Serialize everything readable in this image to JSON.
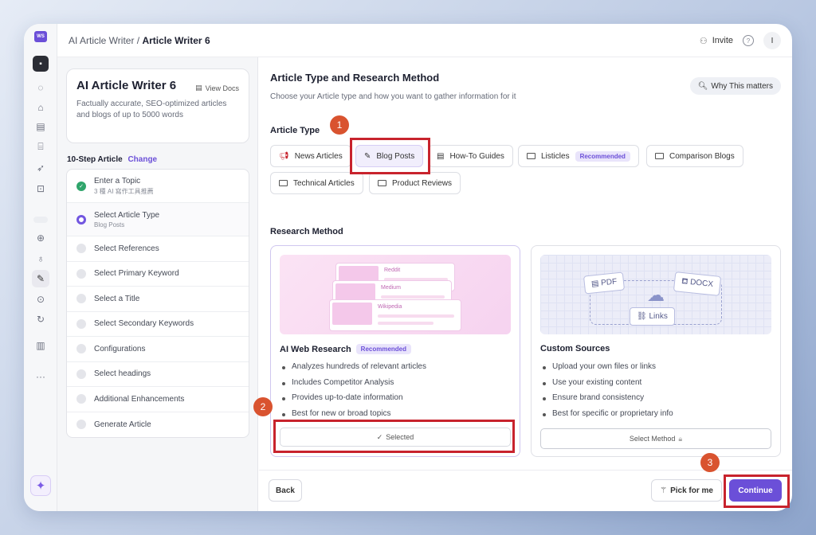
{
  "app": {
    "logo_text": "WS",
    "breadcrumb_parent": "AI Article Writer / ",
    "breadcrumb_current": "Article Writer 6",
    "invite_label": "Invite",
    "help_icon": "?",
    "user_initial": "I"
  },
  "rail": {
    "icons": [
      "layout-icon",
      "spinner-icon",
      "home-icon",
      "document-icon",
      "code-icon",
      "rocket-icon",
      "robot-icon",
      "search-icon",
      "lightbulb-icon",
      "pencil-icon",
      "upload-icon",
      "refresh-icon",
      "chart-icon",
      "more-icon"
    ],
    "more_label": "···",
    "spark_label": "✦"
  },
  "left": {
    "title": "AI Article Writer 6",
    "view_docs": "View Docs",
    "description": "Factually accurate, SEO-optimized articles and blogs of up to 5000 words",
    "step_heading": "10-Step Article",
    "change_label": "Change",
    "steps": [
      {
        "label": "Enter a Topic",
        "sub": "3 種 AI 寫作工具推薦",
        "status": "done"
      },
      {
        "label": "Select Article Type",
        "sub": "Blog Posts",
        "status": "current"
      },
      {
        "label": "Select References",
        "sub": "",
        "status": "pending"
      },
      {
        "label": "Select Primary Keyword",
        "sub": "",
        "status": "pending"
      },
      {
        "label": "Select a Title",
        "sub": "",
        "status": "pending"
      },
      {
        "label": "Select Secondary Keywords",
        "sub": "",
        "status": "pending"
      },
      {
        "label": "Configurations",
        "sub": "",
        "status": "pending"
      },
      {
        "label": "Select headings",
        "sub": "",
        "status": "pending"
      },
      {
        "label": "Additional Enhancements",
        "sub": "",
        "status": "pending"
      },
      {
        "label": "Generate Article",
        "sub": "",
        "status": "pending"
      }
    ]
  },
  "main": {
    "title": "Article Type and Research Method",
    "subtitle": "Choose your Article type and how you want to gather information for it",
    "why_button": "Why This matters",
    "article_type_label": "Article Type",
    "article_types": [
      {
        "label": "News Articles",
        "icon": "megaphone-icon"
      },
      {
        "label": "Blog Posts",
        "icon": "pencil-icon",
        "selected": true
      },
      {
        "label": "How-To Guides",
        "icon": "list-icon"
      },
      {
        "label": "Listicles",
        "icon": "rectangle-icon",
        "badge": "Recommended"
      },
      {
        "label": "Comparison Blogs",
        "icon": "rectangle-icon"
      },
      {
        "label": "Technical Articles",
        "icon": "rectangle-icon"
      },
      {
        "label": "Product Reviews",
        "icon": "rectangle-icon"
      }
    ],
    "research_method_label": "Research Method",
    "methods": [
      {
        "title": "AI Web Research",
        "badge": "Recommended",
        "illus_labels": [
          "Reddit",
          "Medium",
          "Wikipedia"
        ],
        "bullets": [
          "Analyzes hundreds of relevant articles",
          "Includes Competitor Analysis",
          "Provides up-to-date information",
          "Best for new or broad topics"
        ],
        "button": "Selected",
        "selected": true
      },
      {
        "title": "Custom Sources",
        "illus_labels": [
          "PDF",
          "DOCX",
          "Links"
        ],
        "bullets": [
          "Upload your own files or links",
          "Use your existing content",
          "Ensure brand consistency",
          "Best for specific or proprietary info"
        ],
        "button": "Select Method",
        "selected": false
      }
    ],
    "back": "Back",
    "pick_for_me": "Pick for me",
    "continue": "Continue"
  },
  "annotations": {
    "badges": [
      "1",
      "2",
      "3"
    ],
    "highlight_color": "#c8232d"
  },
  "colors": {
    "accent": "#6b4fd8",
    "done_green": "#2fa56b",
    "badge_orange": "#d9532f"
  }
}
